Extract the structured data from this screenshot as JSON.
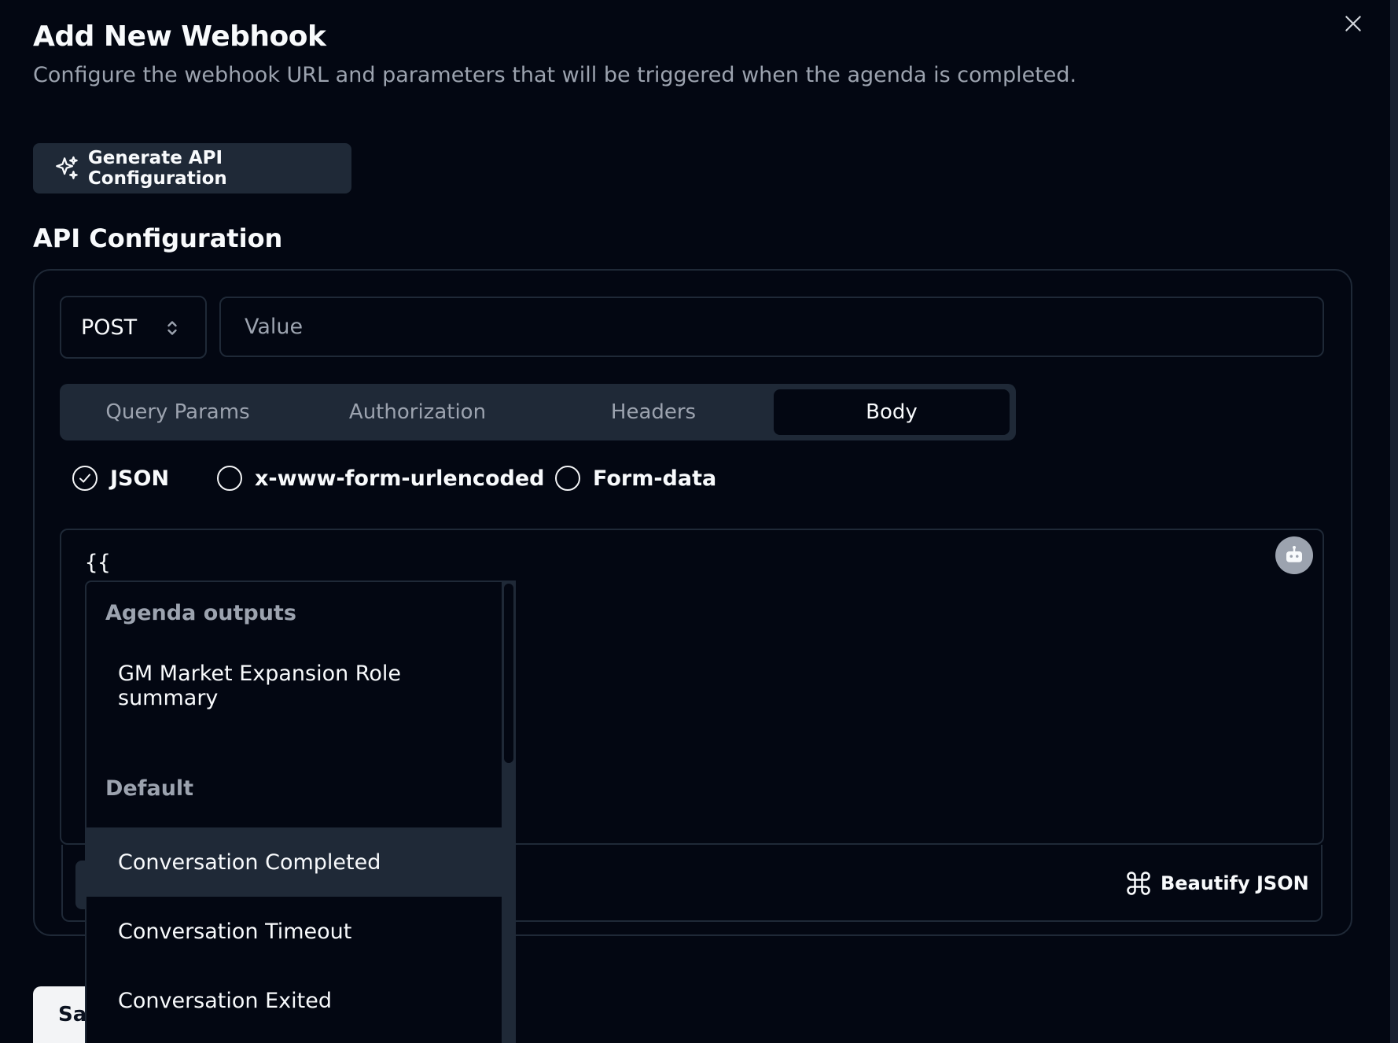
{
  "dialog": {
    "title": "Add New Webhook",
    "subtitle": "Configure the webhook URL and parameters that will be triggered when the agenda is completed.",
    "generate_button": "Generate API Configuration",
    "section_title": "API Configuration"
  },
  "request": {
    "method": "POST",
    "url_placeholder": "Value",
    "url_value": ""
  },
  "tabs": [
    {
      "label": "Query Params",
      "active": false
    },
    {
      "label": "Authorization",
      "active": false
    },
    {
      "label": "Headers",
      "active": false
    },
    {
      "label": "Body",
      "active": true
    }
  ],
  "body_types": [
    {
      "label": "JSON",
      "selected": true
    },
    {
      "label": "x-www-form-urlencoded",
      "selected": false
    },
    {
      "label": "Form-data",
      "selected": false
    }
  ],
  "editor": {
    "content": "{{",
    "beautify_label": "Beautify JSON"
  },
  "dropdown": {
    "groups": [
      {
        "label": "Agenda outputs",
        "items": [
          "GM Market Expansion Role summary"
        ]
      },
      {
        "label": "Default",
        "items": [
          "Conversation Completed",
          "Conversation Timeout",
          "Conversation Exited"
        ]
      }
    ],
    "highlighted": "Conversation Completed"
  },
  "footer": {
    "save_label": "Sa"
  },
  "icons": {
    "close": "close-icon",
    "sparkles": "sparkles-icon",
    "chevrons": "chevron-up-down-icon",
    "bot": "bot-icon",
    "beautify": "beautify-icon"
  }
}
